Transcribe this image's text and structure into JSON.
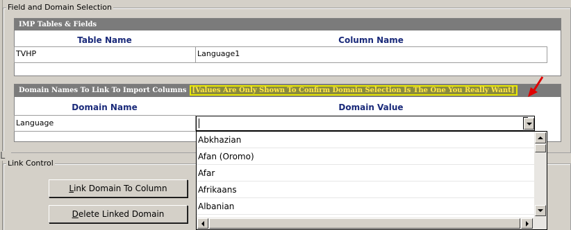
{
  "field_domain_section": {
    "legend": "Field and Domain Selection",
    "imp_tables": {
      "header": "IMP Tables & Fields",
      "columns": [
        "Table Name",
        "Column Name"
      ],
      "rows": [
        {
          "table_name": "TVHP",
          "column_name": "Language1"
        }
      ]
    },
    "domain_link": {
      "header": "Domain Names To Link To Import Columns",
      "notice": "[Values Are Only Shown To Confirm Domain Selection Is The One You Really Want]",
      "columns": [
        "Domain Name",
        "Domain Value"
      ],
      "rows": [
        {
          "domain_name": "Language",
          "domain_value": ""
        }
      ]
    }
  },
  "dropdown": {
    "options": [
      "Abkhazian",
      "Afan (Oromo)",
      "Afar",
      "Afrikaans",
      "Albanian"
    ]
  },
  "link_control": {
    "legend": "Link Control",
    "link_button_accel": "L",
    "link_button_rest": "ink Domain To Column",
    "delete_button_accel": "D",
    "delete_button_rest": "elete Linked Domain"
  },
  "side_tab_text": "L",
  "colors": {
    "dialog_bg": "#d4d0c8",
    "panel_header": "#7b7b7b",
    "column_header_text": "#1a2a7a",
    "notice_text": "#ffe84a",
    "notice_outline": "#e8e800",
    "pointer_arrow": "#e00000"
  },
  "icons": [
    "red-pointer-arrow-icon",
    "dropdown-arrow-icon",
    "scroll-up-icon",
    "scroll-down-icon",
    "scroll-left-icon",
    "scroll-right-icon"
  ]
}
